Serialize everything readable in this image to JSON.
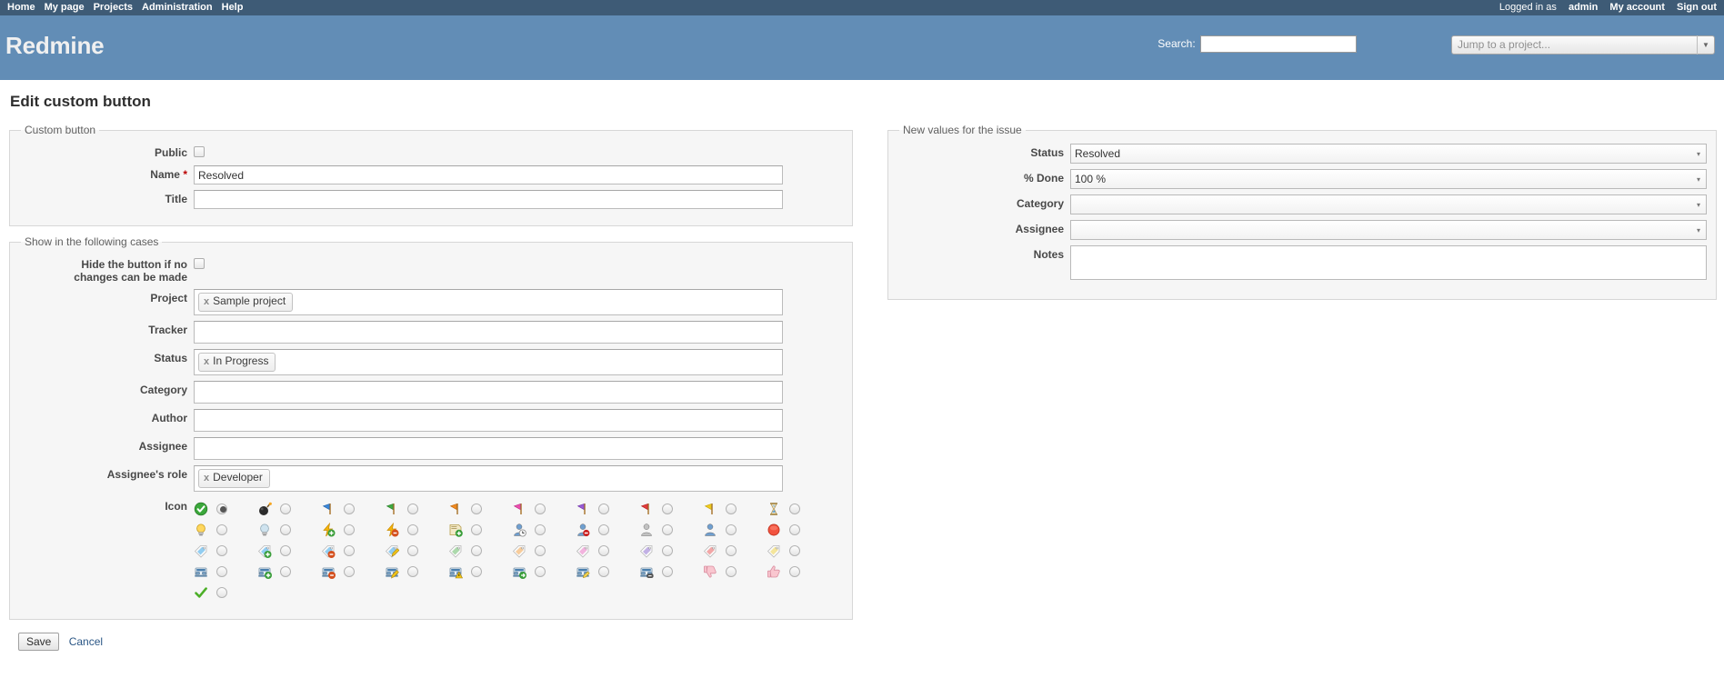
{
  "top_menu": {
    "items": [
      {
        "label": "Home",
        "name": "home"
      },
      {
        "label": "My page",
        "name": "my-page"
      },
      {
        "label": "Projects",
        "name": "projects"
      },
      {
        "label": "Administration",
        "name": "administration"
      },
      {
        "label": "Help",
        "name": "help"
      }
    ],
    "logged_in_prefix": "Logged in as",
    "logged_in_user": "admin",
    "my_account": "My account",
    "sign_out": "Sign out"
  },
  "header": {
    "app_title": "Redmine",
    "search_label": "Search:",
    "search_value": "",
    "project_jump_placeholder": "Jump to a project...",
    "bg_color": "#628db6",
    "menu_bg_color": "#3e5b76"
  },
  "page": {
    "title": "Edit custom button"
  },
  "custom_button": {
    "legend": "Custom button",
    "public_label": "Public",
    "public_checked": false,
    "name_label": "Name",
    "name_required_mark": "*",
    "name_value": "Resolved",
    "title_label": "Title",
    "title_value": ""
  },
  "conditions": {
    "legend": "Show in the following cases",
    "hide_label_line1": "Hide the button if no",
    "hide_label_line2": "changes can be made",
    "hide_checked": false,
    "fields": [
      {
        "label": "Project",
        "name": "project",
        "tokens": [
          "Sample project"
        ]
      },
      {
        "label": "Tracker",
        "name": "tracker",
        "tokens": []
      },
      {
        "label": "Status",
        "name": "status",
        "tokens": [
          "In Progress"
        ]
      },
      {
        "label": "Category",
        "name": "category",
        "tokens": []
      },
      {
        "label": "Author",
        "name": "author",
        "tokens": []
      },
      {
        "label": "Assignee",
        "name": "assignee",
        "tokens": []
      },
      {
        "label": "Assignee's role",
        "name": "assignee-role",
        "tokens": [
          "Developer"
        ]
      }
    ],
    "token_remove_glyph": "x",
    "icon_label": "Icon",
    "icon_rows": [
      [
        {
          "icon": "accept-green-check-icon",
          "selected": true
        },
        {
          "icon": "bomb-icon",
          "selected": false
        },
        {
          "icon": "flag-blue-icon",
          "selected": false
        },
        {
          "icon": "flag-green-icon",
          "selected": false
        },
        {
          "icon": "flag-orange-icon",
          "selected": false
        },
        {
          "icon": "flag-pink-icon",
          "selected": false
        },
        {
          "icon": "flag-purple-icon",
          "selected": false
        },
        {
          "icon": "flag-red-icon",
          "selected": false
        },
        {
          "icon": "flag-yellow-icon",
          "selected": false
        },
        {
          "icon": "hourglass-icon",
          "selected": false
        }
      ],
      [
        {
          "icon": "lightbulb-on-icon",
          "selected": false
        },
        {
          "icon": "lightbulb-off-icon",
          "selected": false
        },
        {
          "icon": "lightning-add-icon",
          "selected": false
        },
        {
          "icon": "lightning-delete-icon",
          "selected": false
        },
        {
          "icon": "note-add-icon",
          "selected": false
        },
        {
          "icon": "user-time-icon",
          "selected": false
        },
        {
          "icon": "user-delete-icon",
          "selected": false
        },
        {
          "icon": "user-gray-icon",
          "selected": false
        },
        {
          "icon": "user-blue-icon",
          "selected": false
        },
        {
          "icon": "stop-red-icon",
          "selected": false
        }
      ],
      [
        {
          "icon": "tag-blue-icon",
          "selected": false
        },
        {
          "icon": "tag-blue-add-icon",
          "selected": false
        },
        {
          "icon": "tag-blue-delete-icon",
          "selected": false
        },
        {
          "icon": "tag-blue-edit-icon",
          "selected": false
        },
        {
          "icon": "tag-green-icon",
          "selected": false
        },
        {
          "icon": "tag-orange-icon",
          "selected": false
        },
        {
          "icon": "tag-pink-icon",
          "selected": false
        },
        {
          "icon": "tag-purple-icon",
          "selected": false
        },
        {
          "icon": "tag-red-icon",
          "selected": false
        },
        {
          "icon": "tag-yellow-icon",
          "selected": false
        }
      ],
      [
        {
          "icon": "telephone-icon",
          "selected": false
        },
        {
          "icon": "telephone-add-icon",
          "selected": false
        },
        {
          "icon": "telephone-delete-icon",
          "selected": false
        },
        {
          "icon": "telephone-edit-icon",
          "selected": false
        },
        {
          "icon": "telephone-error-icon",
          "selected": false
        },
        {
          "icon": "telephone-go-icon",
          "selected": false
        },
        {
          "icon": "telephone-key-icon",
          "selected": false
        },
        {
          "icon": "telephone-link-icon",
          "selected": false
        },
        {
          "icon": "thumb-down-icon",
          "selected": false
        },
        {
          "icon": "thumb-up-icon",
          "selected": false
        }
      ],
      [
        {
          "icon": "tick-green-icon",
          "selected": false
        }
      ]
    ]
  },
  "new_values": {
    "legend": "New values for the issue",
    "fields": [
      {
        "label": "Status",
        "name": "status",
        "value": "Resolved",
        "type": "select"
      },
      {
        "label": "% Done",
        "name": "percent-done",
        "value": "100 %",
        "type": "select"
      },
      {
        "label": "Category",
        "name": "category",
        "value": "",
        "type": "select"
      },
      {
        "label": "Assignee",
        "name": "assignee",
        "value": "",
        "type": "select"
      },
      {
        "label": "Notes",
        "name": "notes",
        "value": "",
        "type": "textarea"
      }
    ],
    "select_arrow_glyph": "▾"
  },
  "actions": {
    "save_label": "Save",
    "cancel_label": "Cancel"
  }
}
